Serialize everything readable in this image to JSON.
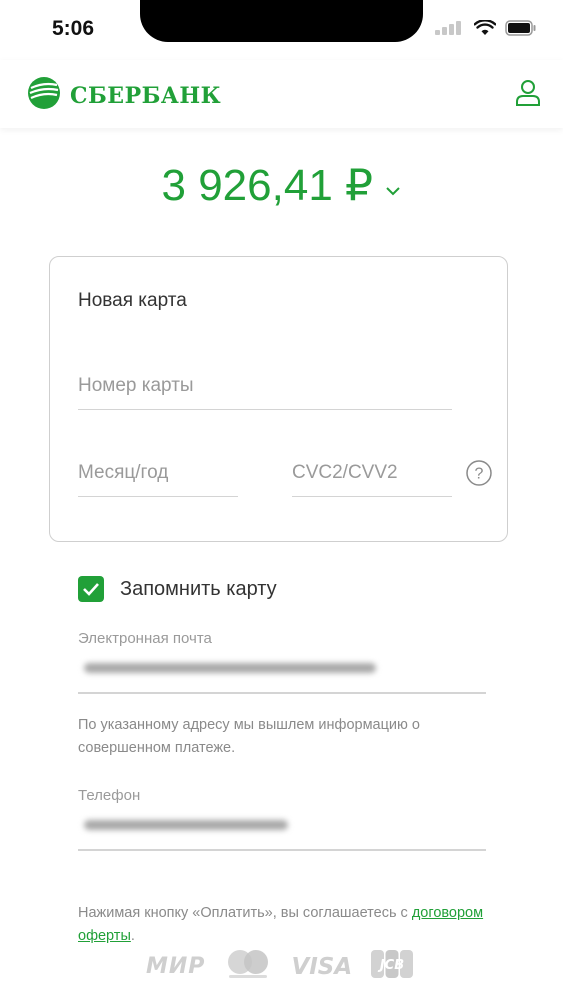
{
  "status_bar": {
    "time": "5:06"
  },
  "header": {
    "brand": "СБЕРБАНК"
  },
  "amount": {
    "value": "3 926,41 ₽"
  },
  "card_form": {
    "title": "Новая карта",
    "card_number_placeholder": "Номер карты",
    "expiry_placeholder": "Месяц/год",
    "cvc_placeholder": "CVC2/CVV2",
    "help_glyph": "?"
  },
  "remember": {
    "label": "Запомнить карту",
    "checked": true
  },
  "email": {
    "label": "Электронная почта",
    "note": "По указанному адресу мы вышлем информацию о совершенном платеже."
  },
  "phone": {
    "label": "Телефон"
  },
  "agreement": {
    "text": "Нажимая кнопку «Оплатить», вы соглашаетесь с",
    "link": "договором оферты",
    "suffix": "."
  },
  "payment_systems": {
    "mir": "МИР",
    "visa": "VISA",
    "jcb": "JCB"
  },
  "colors": {
    "accent": "#21a038"
  }
}
